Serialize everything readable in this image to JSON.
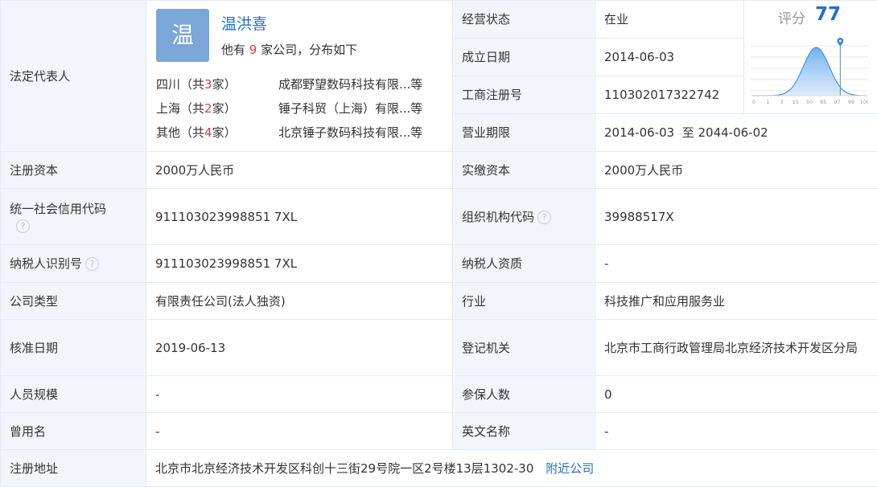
{
  "rep": {
    "label": "法定代表人",
    "avatar_char": "温",
    "name": "温洪喜",
    "sub_pre": "他有 ",
    "sub_count": "9",
    "sub_post": " 家公司，分布如下",
    "dist": [
      {
        "pre": "四川（共",
        "count": "3",
        "post": "家）",
        "company": "成都野望数码科技有限...等"
      },
      {
        "pre": "上海（共",
        "count": "2",
        "post": "家）",
        "company": "锤子科贸（上海）有限...等"
      },
      {
        "pre": "其他（共",
        "count": "4",
        "post": "家）",
        "company": "北京锤子数码科技有限...等"
      }
    ]
  },
  "rows": {
    "status": {
      "label": "经营状态",
      "value": "在业"
    },
    "founded": {
      "label": "成立日期",
      "value": "2014-06-03"
    },
    "reg_no": {
      "label": "工商注册号",
      "value": "110302017322742"
    },
    "period": {
      "label": "营业期限",
      "value": "2014-06-03  至 2044-06-02"
    },
    "reg_capital": {
      "label": "注册资本",
      "value": "2000万人民币"
    },
    "paid_capital": {
      "label": "实缴资本",
      "value": "2000万人民币"
    },
    "credit_code": {
      "label": "统一社会信用代码",
      "value": "911103023998851 7XL"
    },
    "org_code": {
      "label": "组织机构代码",
      "value": "39988517X"
    },
    "taxpayer_id": {
      "label": "纳税人识别号",
      "value": "911103023998851 7XL"
    },
    "taxpayer_qual": {
      "label": "纳税人资质",
      "value": "-"
    },
    "company_type": {
      "label": "公司类型",
      "value": "有限责任公司(法人独资)"
    },
    "industry": {
      "label": "行业",
      "value": "科技推广和应用服务业"
    },
    "approval_date": {
      "label": "核准日期",
      "value": "2019-06-13"
    },
    "authority": {
      "label": "登记机关",
      "value": "北京市工商行政管理局北京经济技术开发区分局"
    },
    "staff_size": {
      "label": "人员规模",
      "value": "-"
    },
    "insured": {
      "label": "参保人数",
      "value": "0"
    },
    "former_name": {
      "label": "曾用名",
      "value": "-"
    },
    "english_name": {
      "label": "英文名称",
      "value": "-"
    },
    "address": {
      "label": "注册地址",
      "value": "北京市北京经济技术开发区科创十三街29号院一区2号楼13层1302-30",
      "link": "附近公司"
    }
  },
  "help_glyph": "?",
  "score": {
    "label": "评分",
    "value": "77",
    "ticks": [
      "0",
      "1",
      "3",
      "15",
      "50",
      "85",
      "97",
      "99",
      "100"
    ],
    "position_fraction": 0.77,
    "accent_color": "#1f6fd1",
    "curve_color": "#4a90e2"
  }
}
